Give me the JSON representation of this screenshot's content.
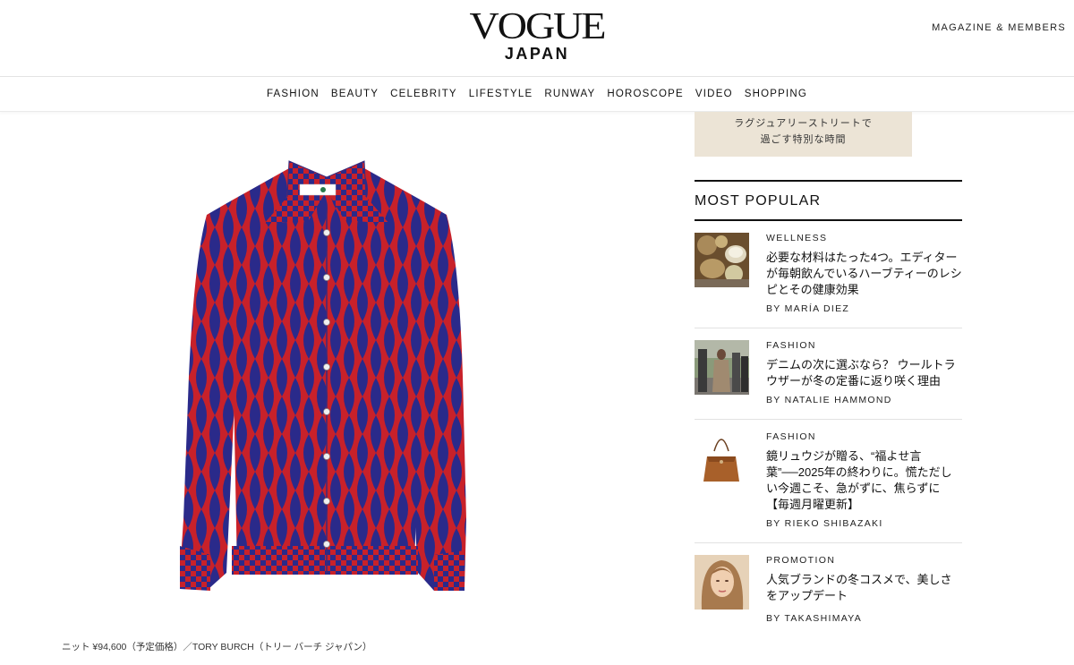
{
  "header": {
    "logo_main": "VOGUE",
    "logo_sub": "JAPAN",
    "members_link": "MAGAZINE & MEMBERS"
  },
  "nav": {
    "items": [
      "FASHION",
      "BEAUTY",
      "CELEBRITY",
      "LIFESTYLE",
      "RUNWAY",
      "HOROSCOPE",
      "VIDEO",
      "SHOPPING"
    ]
  },
  "product": {
    "image_icon": "knit-shirt-image",
    "caption": "ニット ¥94,600（予定価格）／TORY BURCH（トリー バーチ ジャパン）",
    "colors": {
      "red": "#c8212a",
      "navy": "#2a2a8a"
    }
  },
  "sidebar": {
    "banner_line1": "ラグジュアリーストリートで",
    "banner_line2": "過ごす特別な時間",
    "most_popular_title": "MOST POPULAR",
    "items": [
      {
        "category": "WELLNESS",
        "title": "必要な材料はたった4つ。エディターが毎朝飲んでいるハーブティーのレシピとその健康効果",
        "byline": "BY MARÍA DIEZ",
        "thumb_icon": "herbal-tea-ingredients-thumbnail"
      },
      {
        "category": "FASHION",
        "title": "デニムの次に選ぶなら？ ウールトラウザーが冬の定番に返り咲く理由",
        "byline": "BY NATALIE HAMMOND",
        "thumb_icon": "street-style-thumbnail"
      },
      {
        "category": "FASHION",
        "title": "鏡リュウジが贈る、“福よせ言葉”──2025年の終わりに。慌ただしい今週こそ、急がずに、焦らずに【毎週月曜更新】",
        "byline": "BY RIEKO SHIBAZAKI",
        "thumb_icon": "brown-bag-thumbnail"
      },
      {
        "category": "PROMOTION",
        "title": "人気ブランドの冬コスメで、美しさをアップデート",
        "byline": "BY TAKASHIMAYA",
        "thumb_icon": "model-portrait-thumbnail"
      }
    ]
  }
}
